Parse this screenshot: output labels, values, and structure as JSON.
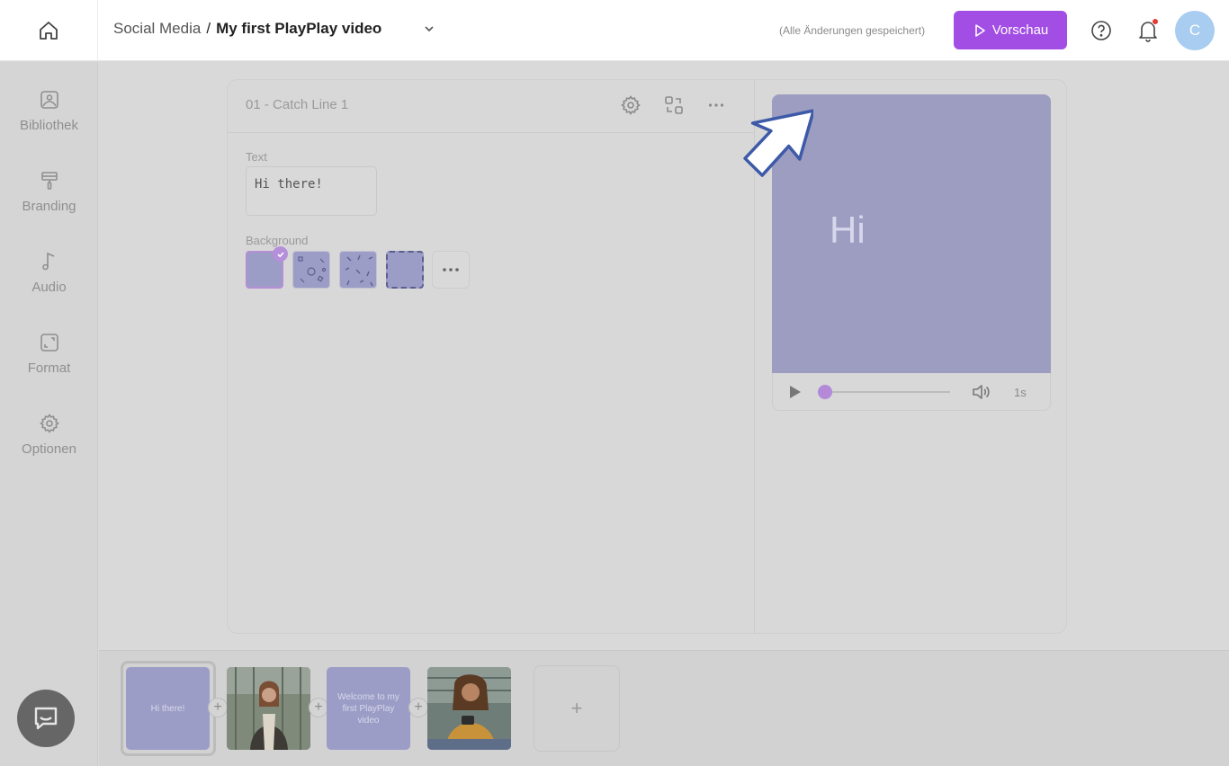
{
  "header": {
    "breadcrumb_parent": "Social Media",
    "breadcrumb_separator": "/",
    "project_title": "My first PlayPlay video",
    "save_status": "(Alle Änderungen gespeichert)",
    "preview_label": "Vorschau",
    "avatar_initial": "C"
  },
  "sidebar": {
    "items": [
      {
        "label": "Bibliothek",
        "icon": "image-icon"
      },
      {
        "label": "Branding",
        "icon": "paint-roller-icon"
      },
      {
        "label": "Audio",
        "icon": "music-note-icon"
      },
      {
        "label": "Format",
        "icon": "resize-icon"
      },
      {
        "label": "Optionen",
        "icon": "gear-icon"
      }
    ]
  },
  "editor": {
    "scene_title": "01 - Catch Line 1",
    "text_label": "Text",
    "text_value": "Hi there!",
    "background_label": "Background"
  },
  "preview": {
    "display_text": "Hi",
    "duration": "1s",
    "progress": 0
  },
  "timeline": {
    "scenes": [
      {
        "type": "text",
        "text": "Hi there!"
      },
      {
        "type": "photo",
        "text": ""
      },
      {
        "type": "text",
        "text": "Welcome to my first PlayPlay video"
      },
      {
        "type": "photo",
        "text": ""
      }
    ],
    "add_label": "+"
  },
  "colors": {
    "accent": "#a24de4",
    "scene_lilac": "#9c9dc6",
    "avatar": "#a8cdf0"
  }
}
